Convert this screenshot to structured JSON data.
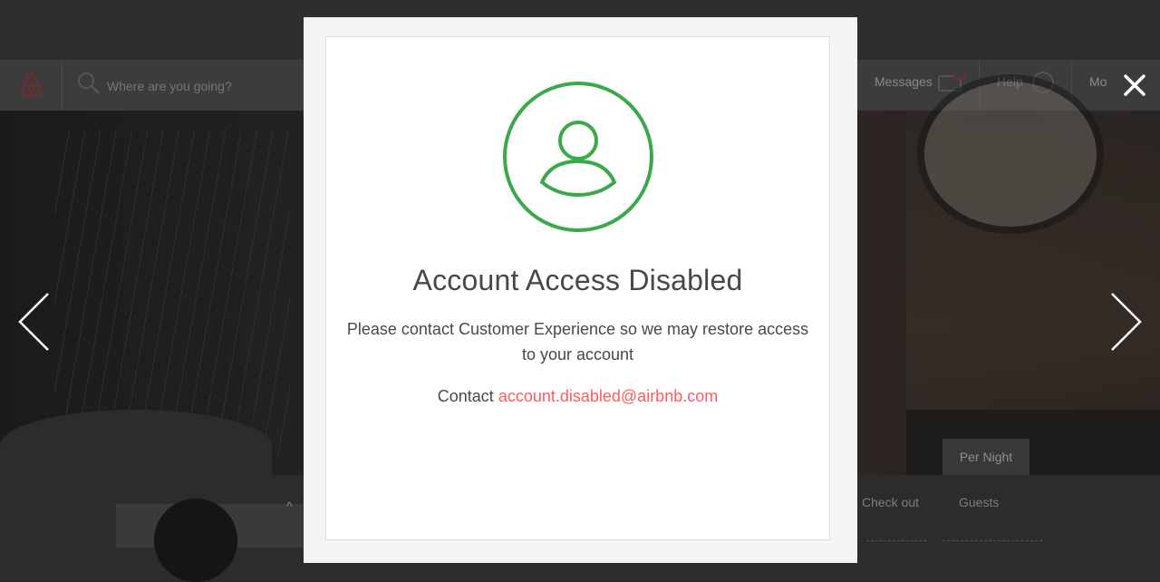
{
  "background": {
    "search": {
      "placeholder": "Where are you going?"
    },
    "nav": {
      "messages_label": "Messages",
      "messages_badge": "1",
      "help_label": "Help",
      "more_label": "Mo"
    },
    "price_period_label": "Per Night",
    "booking": {
      "check_out_label": "Check out",
      "guests_label": "Guests"
    }
  },
  "modal": {
    "title": "Account Access Disabled",
    "message": "Please contact Customer Experience so we may restore access to your account",
    "contact_prefix": "Contact",
    "contact_email": "account.disabled@airbnb.com"
  },
  "icons": {
    "account": "user-circle-icon",
    "close": "close-icon",
    "previous": "chevron-left-icon",
    "next": "chevron-right-icon"
  },
  "colors": {
    "success_green": "#3aa94a",
    "link": "#ff5a5f",
    "text": "#484848",
    "overlay_bg": "#2b2b2b"
  }
}
